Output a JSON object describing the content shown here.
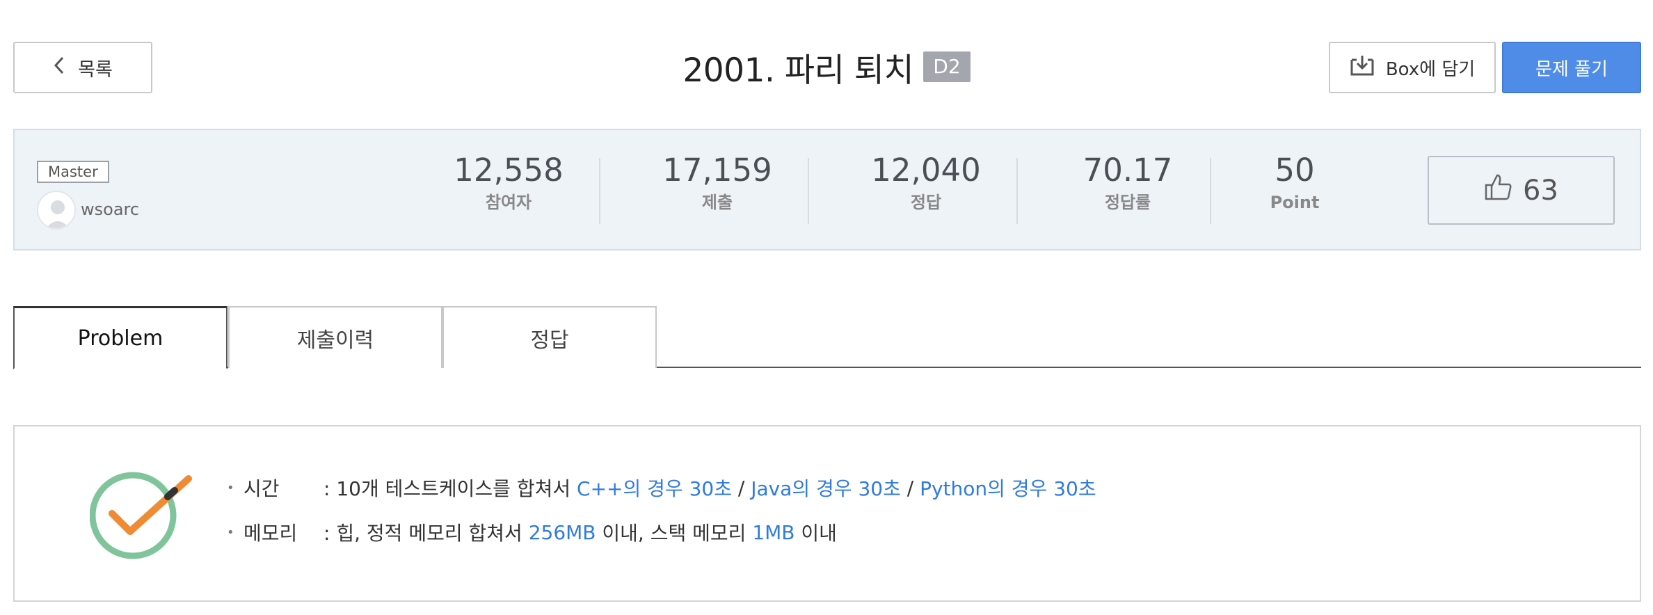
{
  "header": {
    "back_label": "목록",
    "title": "2001. 파리 퇴치",
    "level": "D2",
    "box_label": "Box에 담기",
    "solve_label": "문제 풀기"
  },
  "author": {
    "badge": "Master",
    "name": "wsoarc"
  },
  "stats": [
    {
      "value": "12,558",
      "label": "참여자"
    },
    {
      "value": "17,159",
      "label": "제출"
    },
    {
      "value": "12,040",
      "label": "정답"
    },
    {
      "value": "70.17",
      "label": "정답률"
    },
    {
      "value": "50",
      "label": "Point"
    }
  ],
  "likes": "63",
  "tabs": [
    {
      "label": "Problem",
      "active": true
    },
    {
      "label": "제출이력",
      "active": false
    },
    {
      "label": "정답",
      "active": false
    }
  ],
  "limits": {
    "time_label": "시간",
    "time_prefix": ": 10개 테스트케이스를 합쳐서 ",
    "time_cpp": "C++의 경우 30초",
    "sep1": " / ",
    "time_java": "Java의 경우 30초",
    "sep2": " / ",
    "time_python": "Python의 경우 30초",
    "memory_label": "메모리",
    "memory_prefix": ": 힙, 정적 메모리 합쳐서 ",
    "memory_heap": "256MB",
    "memory_mid": " 이내, 스택 메모리 ",
    "memory_stack": "1MB",
    "memory_suffix": " 이내"
  },
  "colors": {
    "accent": "#4f8ce8",
    "link": "#2f7be2",
    "level_badge": "#a3a7ad"
  },
  "icons": [
    "chevron-left-icon",
    "box-download-icon",
    "thumbs-up-icon",
    "check-circle-icon",
    "avatar-icon"
  ]
}
